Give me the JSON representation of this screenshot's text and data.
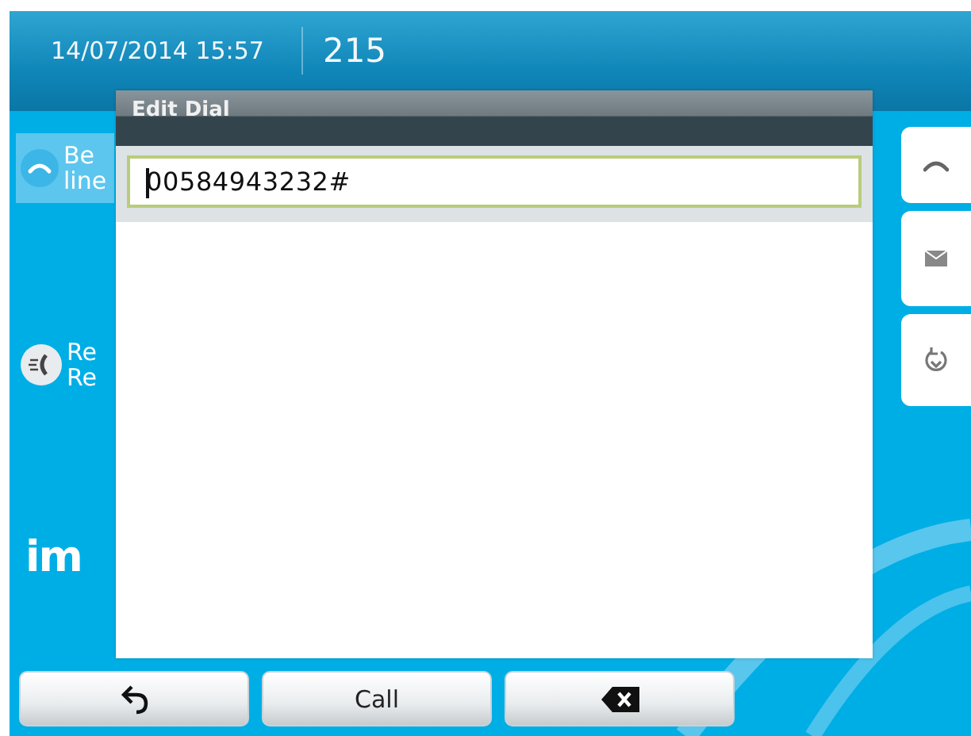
{
  "header": {
    "datetime": "14/07/2014 15:57",
    "extension": "215"
  },
  "lines": [
    {
      "kind": "line",
      "text": [
        "Be",
        "line"
      ]
    },
    {
      "kind": "recent",
      "text": [
        "Re",
        "Re"
      ]
    }
  ],
  "logo": "im",
  "dialog": {
    "title": "Edit Dial",
    "value": "00584943232#"
  },
  "softkeys": [
    {
      "kind": "back"
    },
    {
      "kind": "text",
      "label": "Call"
    },
    {
      "kind": "backspace"
    }
  ]
}
